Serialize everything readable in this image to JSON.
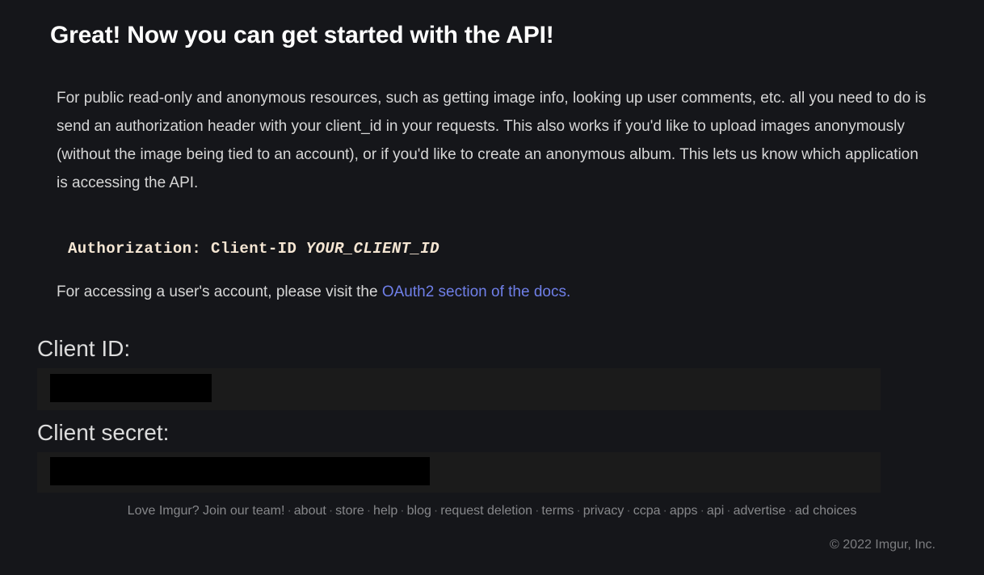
{
  "page": {
    "background_color": "#15161a",
    "panel_color": "#1b1b1b",
    "link_color": "#6f7fe8",
    "code_color": "#f5e6d3"
  },
  "heading": {
    "text": "Great! Now you can get started with the API!"
  },
  "intro": {
    "paragraph": "For public read-only and anonymous resources, such as getting image info, looking up user comments, etc. all you need to do is send an authorization header with your client_id in your requests. This also works if you'd like to upload images anonymously (without the image being tied to an account), or if you'd like to create an anonymous album. This lets us know which application is accessing the API."
  },
  "code": {
    "key": "Authorization: Client-ID",
    "value": "YOUR_CLIENT_ID"
  },
  "oauth": {
    "prefix": "For accessing a user's account, please visit the ",
    "link_text": "OAuth2 section of the docs."
  },
  "credentials": {
    "client_id": {
      "label": "Client ID:",
      "value": "",
      "redacted": true
    },
    "client_secret": {
      "label": "Client secret:",
      "value": "",
      "redacted": true
    }
  },
  "footer": {
    "links": [
      {
        "label": "Love Imgur? Join our team!"
      },
      {
        "label": "about"
      },
      {
        "label": "store"
      },
      {
        "label": "help"
      },
      {
        "label": "blog"
      },
      {
        "label": "request deletion"
      },
      {
        "label": "terms"
      },
      {
        "label": "privacy"
      },
      {
        "label": "ccpa"
      },
      {
        "label": "apps"
      },
      {
        "label": "api"
      },
      {
        "label": "advertise"
      },
      {
        "label": "ad choices"
      }
    ],
    "separator": "·",
    "copyright": "© 2022 Imgur, Inc."
  }
}
